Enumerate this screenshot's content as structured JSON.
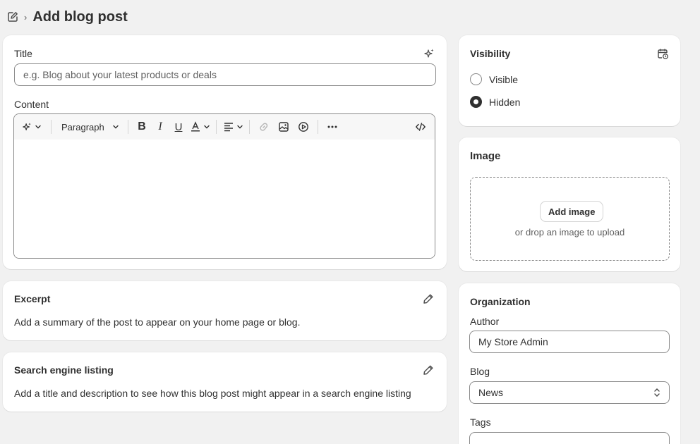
{
  "page": {
    "title": "Add blog post"
  },
  "main": {
    "title_label": "Title",
    "title_placeholder": "e.g. Blog about your latest products or deals",
    "content_label": "Content",
    "toolbar": {
      "paragraph_label": "Paragraph"
    }
  },
  "excerpt": {
    "heading": "Excerpt",
    "description": "Add a summary of the post to appear on your home page or blog."
  },
  "seo": {
    "heading": "Search engine listing",
    "description": "Add a title and description to see how this blog post might appear in a search engine listing"
  },
  "visibility": {
    "heading": "Visibility",
    "options": [
      {
        "label": "Visible",
        "checked": false
      },
      {
        "label": "Hidden",
        "checked": true
      }
    ]
  },
  "image": {
    "heading": "Image",
    "add_button": "Add image",
    "drop_hint": "or drop an image to upload"
  },
  "organization": {
    "heading": "Organization",
    "author_label": "Author",
    "author_value": "My Store Admin",
    "blog_label": "Blog",
    "blog_value": "News",
    "tags_label": "Tags"
  }
}
